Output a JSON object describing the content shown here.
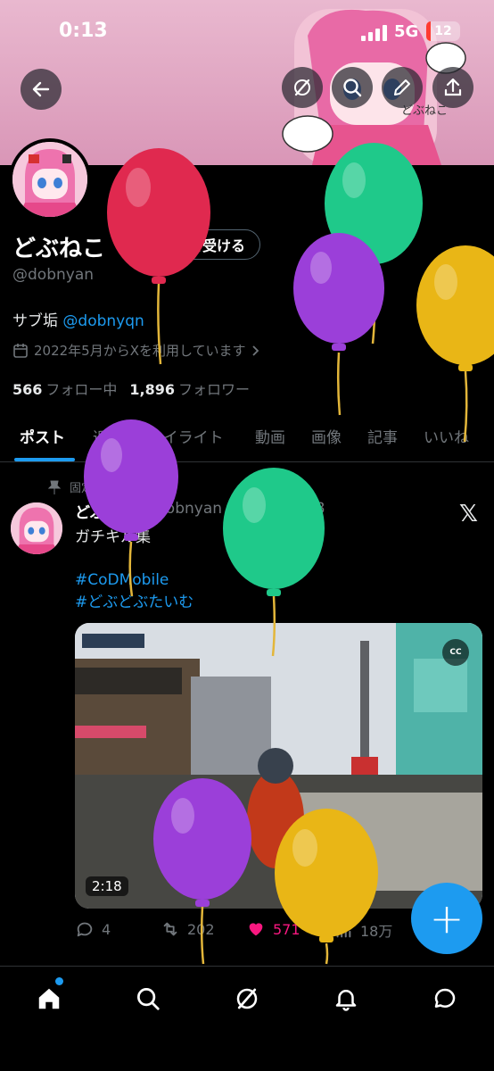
{
  "status_bar": {
    "time": "0:13",
    "network": "5G",
    "battery": "12"
  },
  "header_buttons": [
    {
      "name": "back-button",
      "icon": "arrow-left-icon"
    },
    {
      "name": "grok-button",
      "icon": "grok-icon"
    },
    {
      "name": "search-button",
      "icon": "search-icon"
    },
    {
      "name": "edit-button",
      "icon": "pencil-icon"
    },
    {
      "name": "share-button",
      "icon": "share-icon"
    }
  ],
  "profile": {
    "name": "どぶねこ",
    "verify_label": "認証を受ける",
    "handle": "@dobnyan",
    "bio_prefix": "サブ垢 ",
    "bio_mention": "@dobnyqn",
    "joined": "2022年5月からXを利用しています",
    "following_count": "566",
    "following_label": "フォロー中",
    "followers_count": "1,896",
    "followers_label": "フォロワー"
  },
  "tabs": [
    "ポスト",
    "返信",
    "ハイライト",
    "動画",
    "画像",
    "記事",
    "いいね"
  ],
  "active_tab": 0,
  "post": {
    "pinned_label": "固定",
    "name": "どぶねこ",
    "handle": "@dobnyan",
    "dot": "·",
    "date": "2024/12/28",
    "text": "ガチキル集",
    "hashtags": [
      "#CoDMobile",
      "#どぶどぶたいむ"
    ],
    "video_duration": "2:18",
    "cc_label": "CC",
    "replies": "4",
    "reposts": "202",
    "likes": "571",
    "views": "18万"
  },
  "fab_label": "+",
  "bottom_nav": [
    "home-icon",
    "search-icon",
    "grok-icon",
    "bell-icon",
    "messages-icon"
  ],
  "colors": {
    "accent": "#1d9bf0",
    "like": "#f91880",
    "muted": "#71767b",
    "banner": "#e0a6c2"
  },
  "balloons": [
    {
      "color": "#e0294f"
    },
    {
      "color": "#1fc98a"
    },
    {
      "color": "#9b3fd9"
    },
    {
      "color": "#e9b616"
    },
    {
      "color": "#9b3fd9"
    },
    {
      "color": "#1fc98a"
    },
    {
      "color": "#9b3fd9"
    },
    {
      "color": "#e9b616"
    }
  ]
}
